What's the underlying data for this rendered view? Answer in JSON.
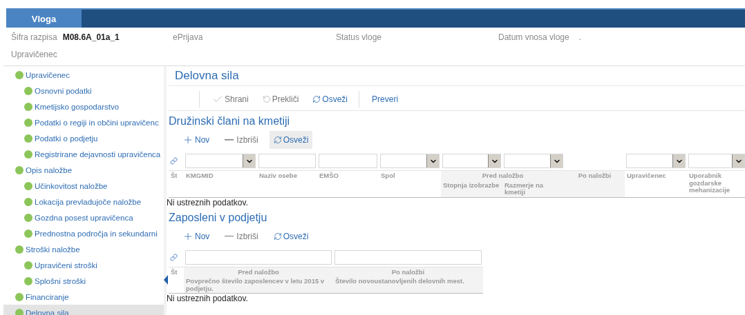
{
  "tabs": [
    {
      "label": "Vloga",
      "selected": true
    }
  ],
  "info": [
    {
      "label": "Šifra razpisa",
      "value": "M08.6A_01a_1"
    },
    {
      "label": "ePrijava"
    },
    {
      "label": "Status vloge"
    },
    {
      "label": "Datum vnosa vloge",
      "value": "."
    }
  ],
  "info_label_2": "Upravičenec",
  "sidebar": {
    "items": [
      {
        "label": "Upravičenec",
        "selected": false,
        "children": [
          {
            "label": "Osnovni podatki",
            "selected": false
          },
          {
            "label": "Kmetijsko gospodarstvo",
            "selected": false
          },
          {
            "label": "Podatki o regiji in občini upravičenc",
            "selected": false
          },
          {
            "label": "Podatki o podjetju",
            "selected": false
          },
          {
            "label": "Registrirane dejavnosti upravičenca",
            "selected": false
          }
        ]
      },
      {
        "label": "Opis naložbe",
        "selected": false,
        "children": [
          {
            "label": "Učinkovitost naložbe",
            "selected": false
          },
          {
            "label": "Lokacija prevladujoče naložbe",
            "selected": false
          },
          {
            "label": "Gozdna posest upravičenca",
            "selected": false
          },
          {
            "label": "Prednostna področja in sekundarni",
            "selected": false
          }
        ]
      },
      {
        "label": "Stroški naložbe",
        "selected": false,
        "children": [
          {
            "label": "Upravičeni stroški",
            "selected": false
          },
          {
            "label": "Splošni stroški",
            "selected": false
          }
        ]
      },
      {
        "label": "Financiranje",
        "selected": false
      },
      {
        "label": "Delovna sila",
        "selected": true
      }
    ]
  },
  "main": {
    "title": "Delovna sila",
    "toolbar": [
      {
        "label": "Shrani",
        "kind": "save",
        "disabled": true
      },
      {
        "label": "Prekliči",
        "kind": "cancel",
        "disabled": true
      },
      {
        "label": "Osveži",
        "kind": "refresh",
        "disabled": false
      },
      {
        "label": "Preveri",
        "kind": "check",
        "disabled": false
      }
    ],
    "sections": [
      {
        "title": "Družinski člani na kmetiji",
        "buttons": [
          {
            "label": "Nov",
            "kind": "add",
            "hovered": false
          },
          {
            "label": "Izbriši",
            "kind": "delete",
            "hovered": false
          },
          {
            "label": "Osveži",
            "kind": "refresh",
            "hovered": true
          }
        ],
        "row_number_header": "Št",
        "columns": [
          {
            "label": "KMGMID",
            "filter": {
              "kind": "select"
            }
          },
          {
            "label": "Naziv osebe",
            "filter": {
              "kind": "input"
            }
          },
          {
            "label": "EMŠO",
            "filter": {
              "kind": "input"
            }
          },
          {
            "label": "Spol",
            "filter": {
              "kind": "select"
            }
          },
          {
            "group": "Pred naložbo",
            "columns": [
              {
                "label": "Stopnja izobrazbe",
                "filter": {
                  "kind": "select"
                }
              },
              {
                "label": "Razmerje na kmetiji",
                "filter": {
                  "kind": "select"
                }
              }
            ]
          },
          {
            "group": "Po naložbi",
            "columns": [
              {}
            ]
          },
          {
            "label": "Upravičenec",
            "filter": {
              "kind": "select"
            }
          },
          {
            "label": "Uporabnik gozdarske mehanizacije",
            "filter": {
              "kind": "select"
            }
          }
        ],
        "empty_message": "Ni ustreznih podatkov."
      },
      {
        "title": "Zaposleni v podjetju",
        "buttons": [
          {
            "label": "Nov",
            "kind": "add",
            "hovered": false
          },
          {
            "label": "Izbriši",
            "kind": "delete",
            "hovered": false
          },
          {
            "label": "Osveži",
            "kind": "refresh",
            "hovered": false
          }
        ],
        "row_number_header": "Št",
        "columns": [
          {
            "group": "Pred naložbo",
            "columns": [
              {
                "label": "Povprečno število zaposlencev v letu 2015 v podjetju.",
                "filter": {
                  "kind": "input"
                }
              }
            ]
          },
          {
            "group": "Po naložbi",
            "columns": [
              {
                "label": "Število novoustanovljenih delovnih mest.",
                "filter": {
                  "kind": "input"
                }
              }
            ]
          }
        ],
        "empty_message": "Ni ustreznih podatkov."
      }
    ]
  }
}
